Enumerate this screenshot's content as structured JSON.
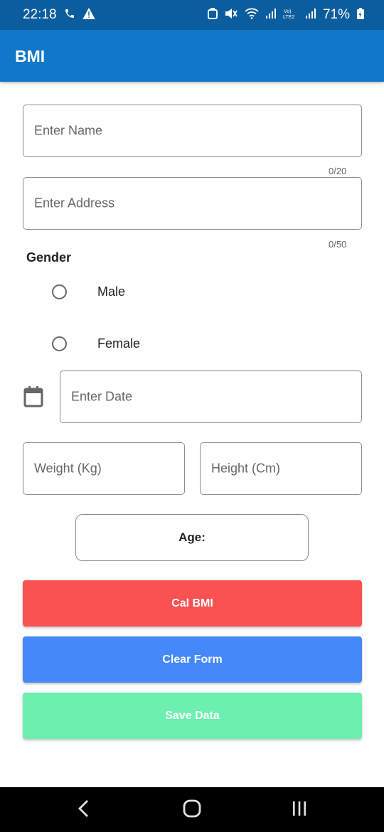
{
  "status_bar": {
    "time": "22:18",
    "battery": "71%",
    "icons": [
      "phone-icon",
      "warning-icon",
      "notification-icon",
      "mute-icon",
      "wifi-icon",
      "signal-icon",
      "volte-icon",
      "signal-icon",
      "battery-icon"
    ]
  },
  "app_bar": {
    "title": "BMI",
    "color": "#1177c8"
  },
  "form": {
    "name": {
      "placeholder": "Enter Name",
      "counter": "0/20"
    },
    "address": {
      "placeholder": "Enter Address",
      "counter": "0/50"
    },
    "gender": {
      "label": "Gender",
      "options": [
        {
          "label": "Male",
          "selected": false
        },
        {
          "label": "Female",
          "selected": false
        }
      ]
    },
    "date": {
      "placeholder": "Enter Date",
      "icon": "calendar-icon"
    },
    "weight": {
      "placeholder": "Weight (Kg)"
    },
    "height": {
      "placeholder": "Height (Cm)"
    },
    "age": {
      "label": "Age:"
    }
  },
  "buttons": {
    "calc": {
      "label": "Cal BMI",
      "color": "#fa5252"
    },
    "clear": {
      "label": "Clear Form",
      "color": "#4488fa"
    },
    "save": {
      "label": "Save Data",
      "color": "#6cefaf"
    }
  },
  "nav_bar": {
    "icons": [
      "back-icon",
      "home-icon",
      "recent-apps-icon"
    ]
  }
}
